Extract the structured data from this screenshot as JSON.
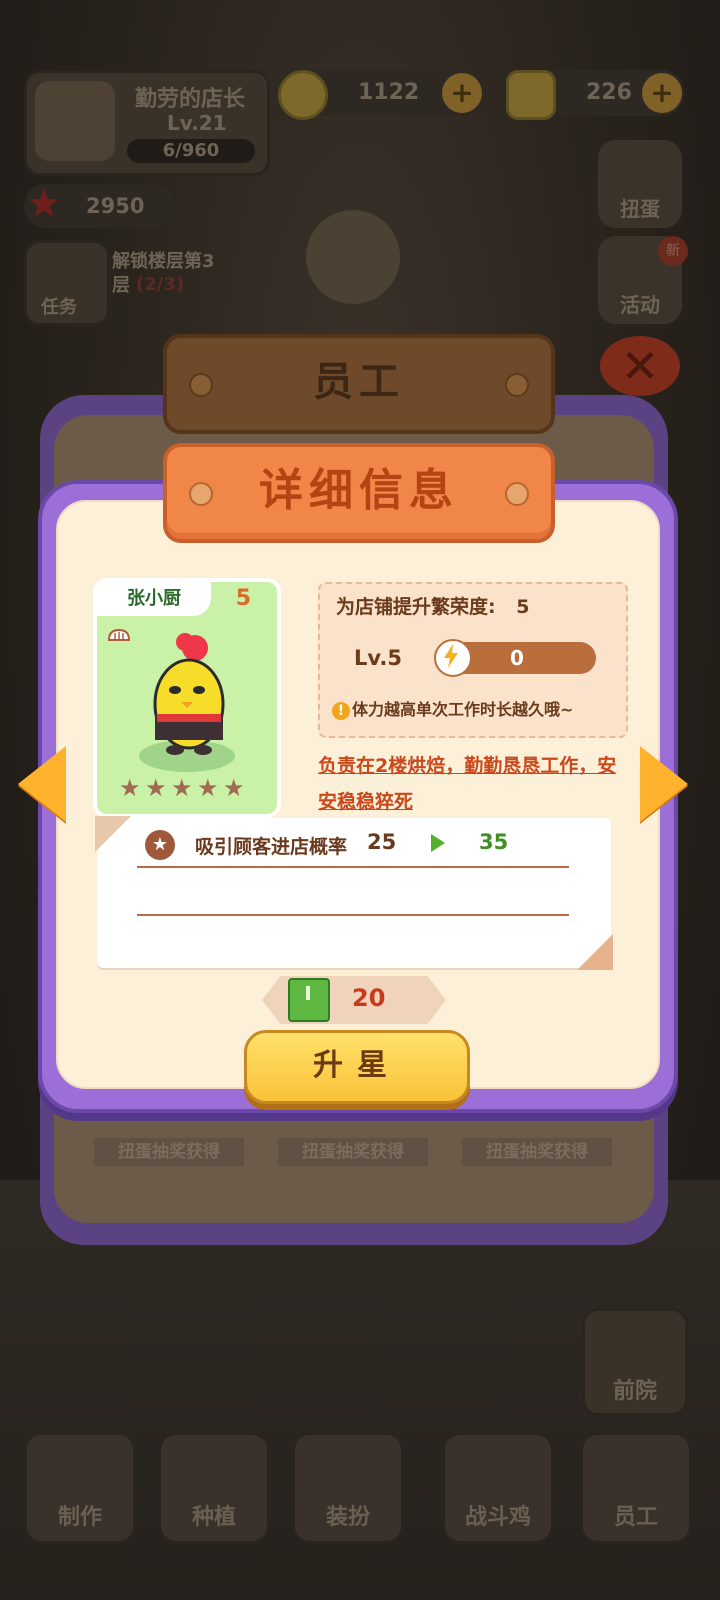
{
  "hud": {
    "player_name": "勤劳的店长",
    "player_level": "Lv.21",
    "exp": "6/960",
    "coins": "1122",
    "gems": "226",
    "stars": "2950",
    "task_text": "解锁楼层第3层",
    "task_progress": "(2/3)",
    "task_label": "任务"
  },
  "side": {
    "gacha_label": "扭蛋",
    "event_label": "活动",
    "new_badge": "新",
    "yard_label": "前院"
  },
  "bottom_nav": [
    {
      "label": "制作"
    },
    {
      "label": "种植"
    },
    {
      "label": "装扮"
    },
    {
      "label": "战斗鸡"
    },
    {
      "label": "员工"
    }
  ],
  "dialog": {
    "staff_title": "员工",
    "detail_title": "详细信息",
    "character": {
      "name": "张小厨",
      "level": "5",
      "stars": 5
    },
    "prosperity_label": "为店铺提升繁荣度:",
    "prosperity_value": "5",
    "level_label": "Lv.5",
    "energy_value": "0",
    "hint": "体力越高单次工作时长越久哦~",
    "description": "负责在2楼烘焙，勤勤恳恳工作，安安稳稳猝死",
    "skill": {
      "text": "吸引顾客进店概率",
      "from": "25",
      "to": "35"
    },
    "cost": "20",
    "upgrade_label": "升星",
    "obtain_labels": [
      "扭蛋抽奖获得",
      "扭蛋抽奖获得",
      "扭蛋抽奖获得"
    ]
  },
  "colors": {
    "frame": "#9c6ed8",
    "plank": "#f08648",
    "button": "#fbc23a",
    "card": "#c9f2a8"
  }
}
